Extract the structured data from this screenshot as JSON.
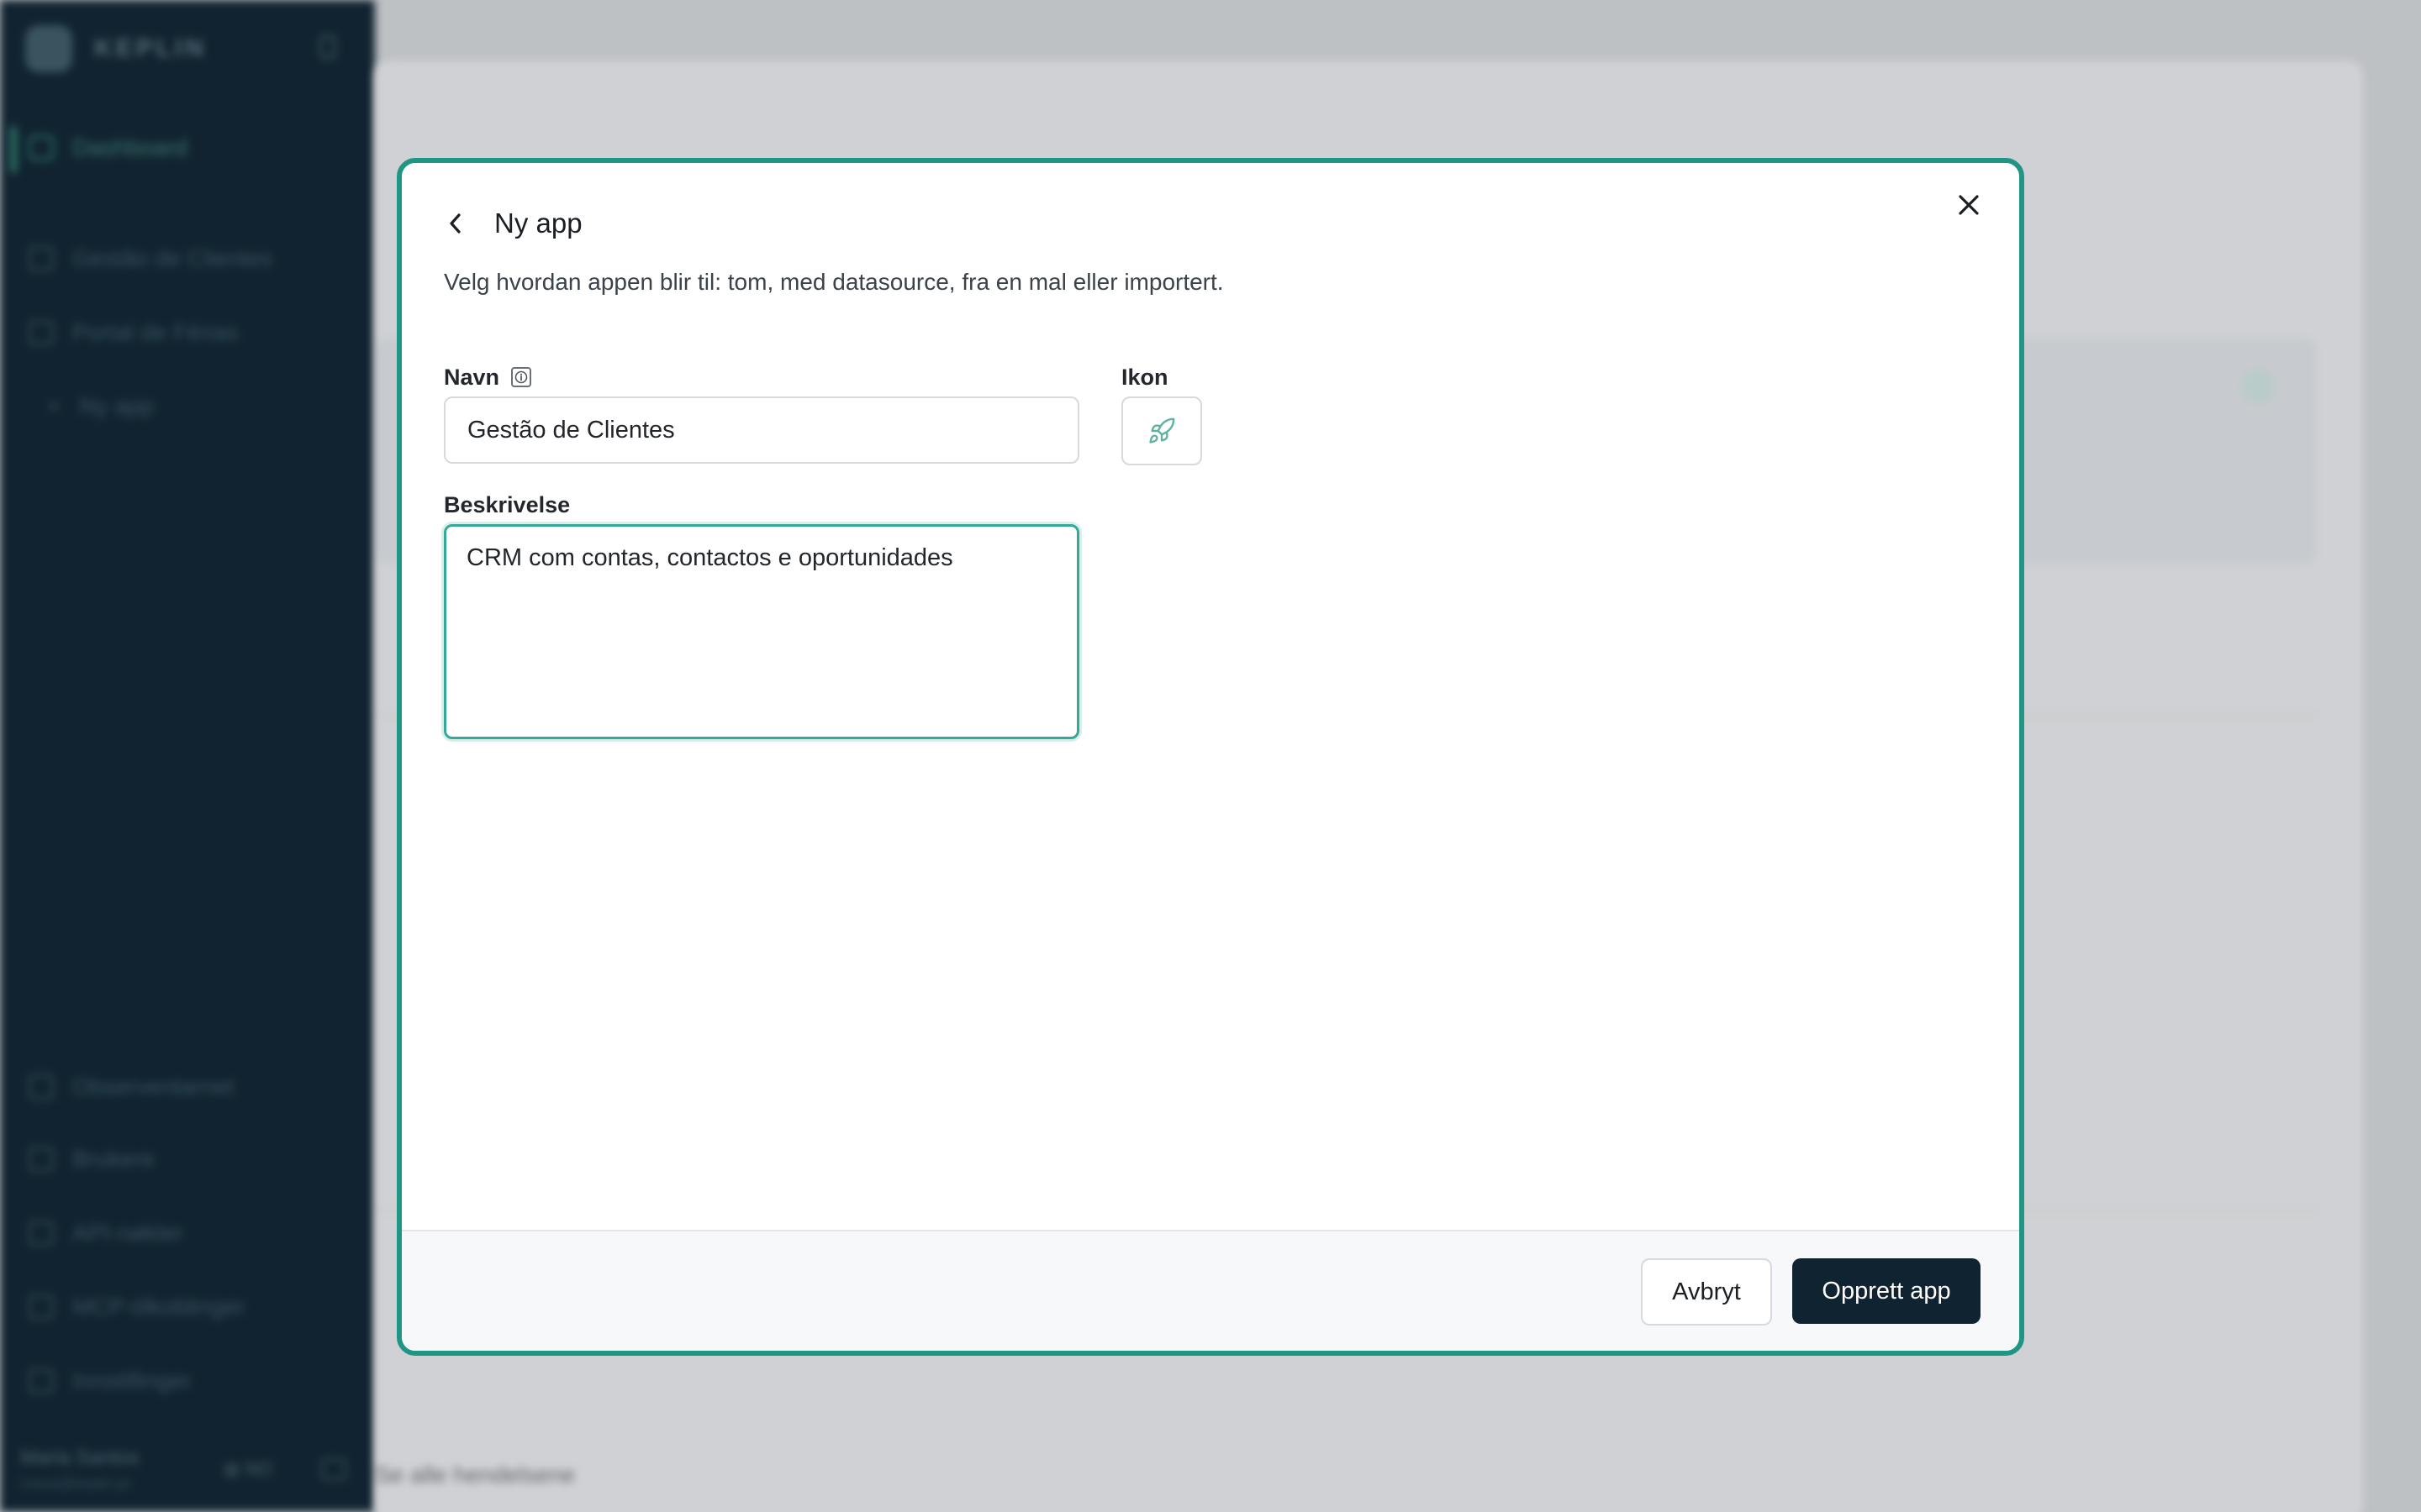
{
  "background": {
    "sidebar": {
      "brand": "KEPLIN",
      "items": [
        {
          "label": "Dashboard",
          "icon": "dashboard-icon"
        },
        {
          "label": "Gestão de Clientes",
          "icon": "app-icon"
        },
        {
          "label": "Portal de Férias",
          "icon": "rocket-icon"
        },
        {
          "label": "Ny app",
          "icon": "plus-icon"
        },
        {
          "label": "Observentarnet",
          "icon": "chart-icon"
        },
        {
          "label": "Brukere",
          "icon": "users-icon"
        },
        {
          "label": "API-nøkler",
          "icon": "key-icon"
        },
        {
          "label": "MCP-tilkoblinger",
          "icon": "plug-icon"
        },
        {
          "label": "Innstillinger",
          "icon": "gear-icon"
        }
      ],
      "user_name": "Maria Santos",
      "user_email": "maria@keplin.pt",
      "language": "NO"
    },
    "main": {
      "footer_text": "Se alle hendelsene"
    }
  },
  "modal": {
    "title": "Ny app",
    "description": "Velg hvordan appen blir til: tom, med datasource, fra en mal eller importert.",
    "fields": {
      "name_label": "Navn",
      "name_value": "Gestão de Clientes",
      "icon_label": "Ikon",
      "icon_value": "rocket-icon",
      "description_label": "Beskrivelse",
      "description_value": "CRM com contas, contactos e oportunidades"
    },
    "buttons": {
      "cancel": "Avbryt",
      "create": "Opprett app"
    }
  },
  "colors": {
    "accent": "#1f9584",
    "primary_button": "#0f2330",
    "sidebar": "#0f2330"
  }
}
